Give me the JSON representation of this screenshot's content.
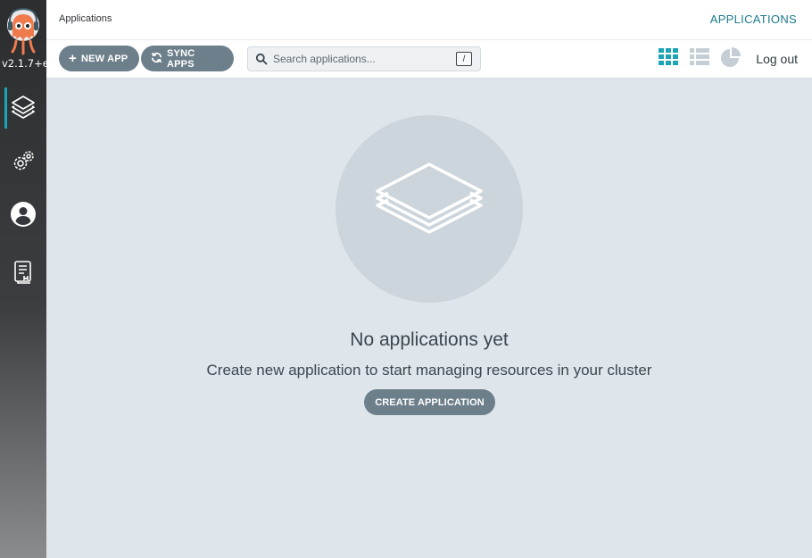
{
  "app": {
    "version": "v2.1.7+e",
    "logo_icon": "octopus-logo-icon"
  },
  "sidebar": {
    "items": [
      {
        "name": "applications",
        "icon": "layers-icon",
        "active": true
      },
      {
        "name": "settings",
        "icon": "gears-icon",
        "active": false
      },
      {
        "name": "user-info",
        "icon": "user-circle-icon",
        "active": false
      },
      {
        "name": "documentation",
        "icon": "book-icon",
        "active": false
      }
    ]
  },
  "header": {
    "title": "Applications",
    "section_link": "APPLICATIONS"
  },
  "toolbar": {
    "new_app_label": "NEW APP",
    "sync_apps_label": "SYNC APPS",
    "search_placeholder": "Search applications...",
    "search_shortcut": "/",
    "logout_label": "Log out",
    "views": [
      "tiles-view-icon",
      "list-view-icon",
      "summary-view-icon"
    ]
  },
  "empty_state": {
    "title": "No applications yet",
    "subtitle": "Create new application to start managing resources in your cluster",
    "create_label": "CREATE APPLICATION"
  },
  "colors": {
    "accent": "#19a5b5",
    "button": "#6d7f8b",
    "background": "#dee6eb",
    "header_link": "#1c7a8a"
  }
}
